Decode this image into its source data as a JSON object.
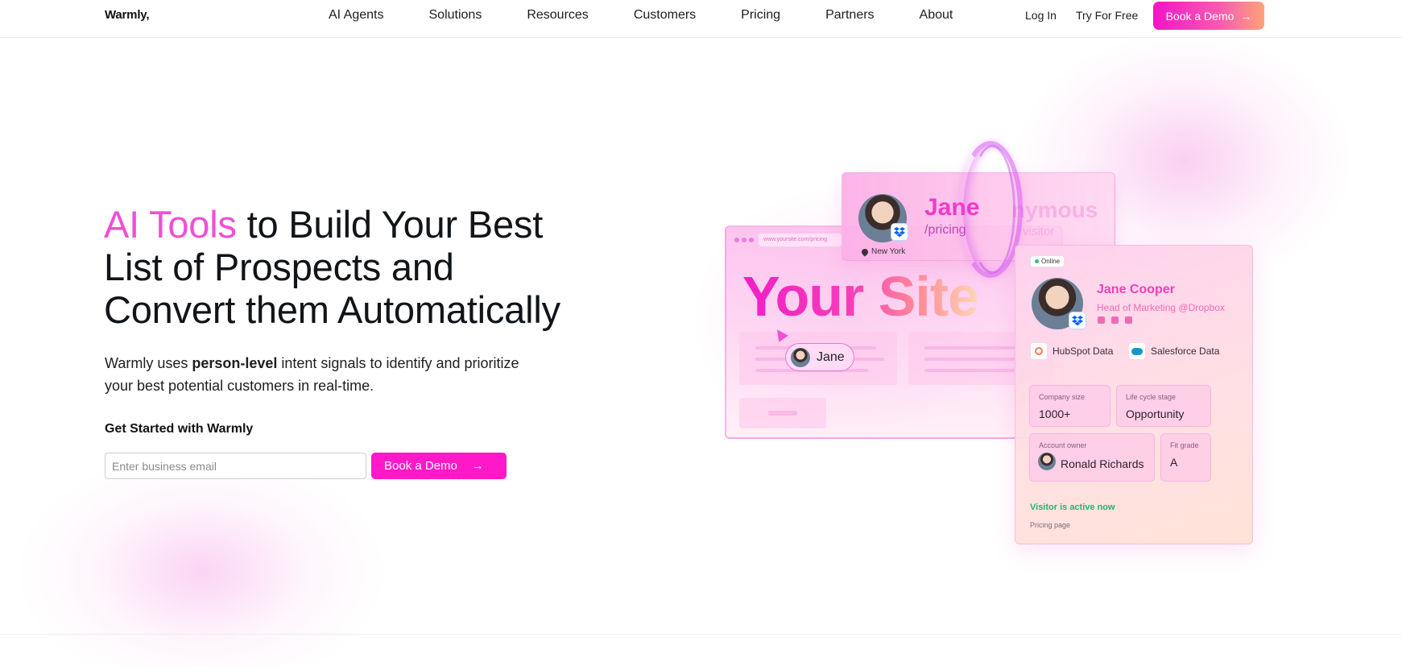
{
  "header": {
    "logo": "Warmly,",
    "nav": [
      "AI Agents",
      "Solutions",
      "Resources",
      "Customers",
      "Pricing",
      "Partners",
      "About"
    ],
    "login": "Log In",
    "try_free": "Try For Free",
    "book_demo": "Book a Demo"
  },
  "hero": {
    "title_accent": "AI Tools",
    "title_rest_1": " to Build Your Best",
    "title_line_2": "List of Prospects and",
    "title_line_3": "Convert them Automatically",
    "sub_prefix": "Warmly uses ",
    "sub_bold": "person-level",
    "sub_rest": " intent signals to identify and prioritize your best potential customers in real-time.",
    "get_started": "Get Started with Warmly",
    "email_placeholder": "Enter business email",
    "book_demo": "Book a Demo"
  },
  "illustration": {
    "url": "www.yoursite.com/pricing",
    "your_site": "Your Site",
    "chip_name": "Jane",
    "top_card": {
      "name": "Jane",
      "path": "/pricing",
      "anon": "nymous",
      "visitor": "visitor",
      "location": "New York"
    },
    "profile": {
      "status": "Online",
      "name": "Jane Cooper",
      "role": "Head of Marketing @Dropbox",
      "sources": [
        "HubSpot Data",
        "Salesforce Data"
      ],
      "company_size_label": "Company size",
      "company_size": "1000+",
      "lifecycle_label": "Life cycle stage",
      "lifecycle": "Opportunity",
      "owner_label": "Account owner",
      "owner": "Ronald Richards",
      "fit_label": "Fit grade",
      "fit": "A",
      "active": "Visitor is active now",
      "page": "Pricing page"
    }
  },
  "colors": {
    "accent": "#f04fd6",
    "button": "#ff19c8",
    "active_green": "#23b56e"
  }
}
